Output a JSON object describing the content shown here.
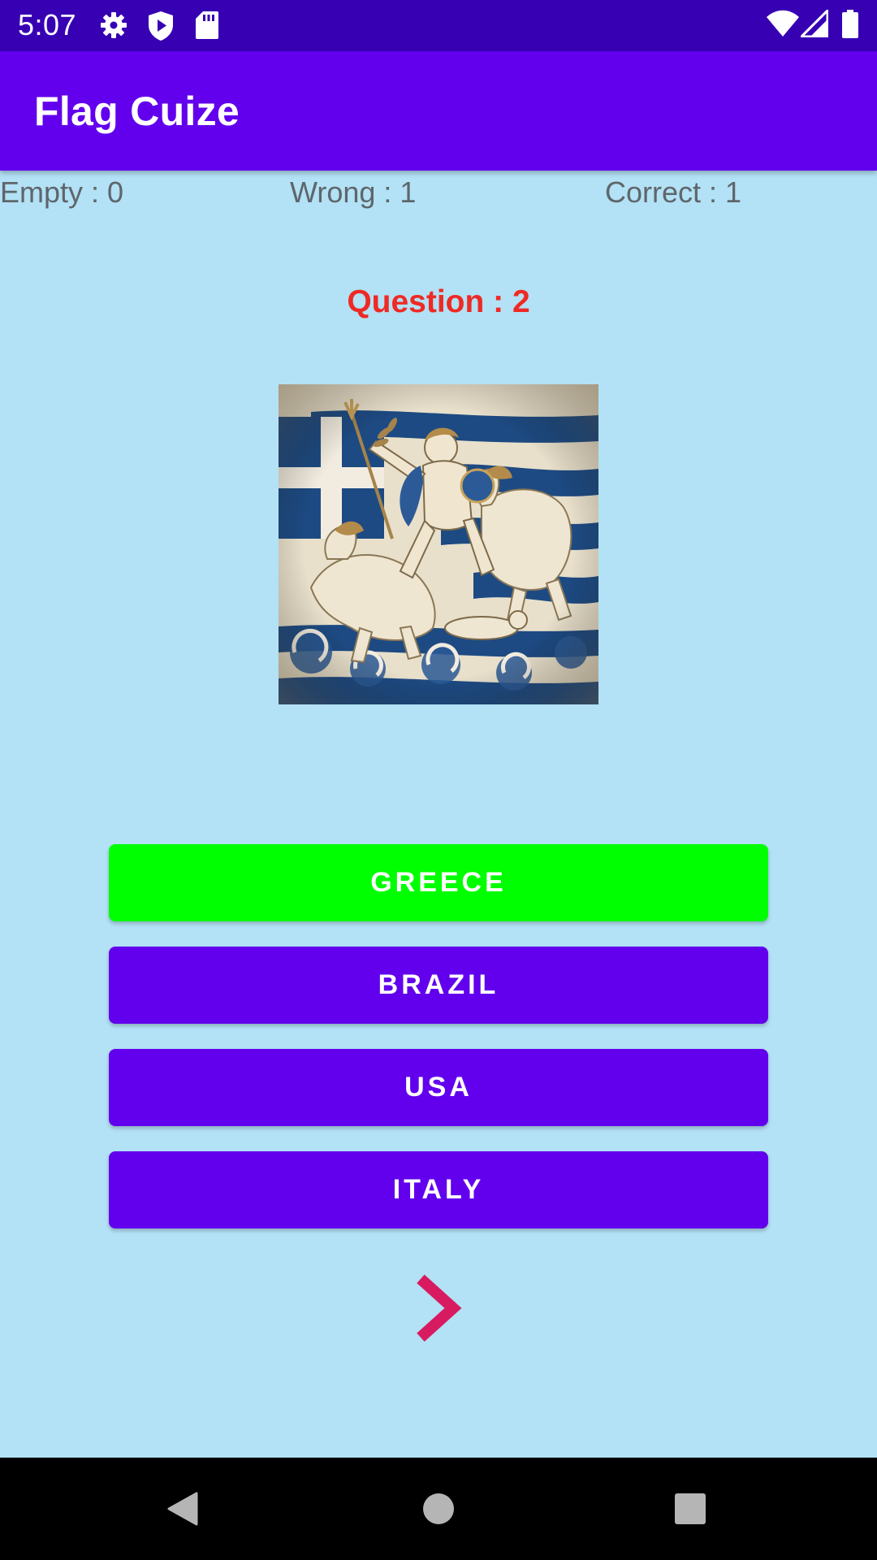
{
  "status_bar": {
    "time": "5:07",
    "icons": [
      "gear-icon",
      "shield-play-icon",
      "sd-card-icon",
      "wifi-icon",
      "cell-signal-icon",
      "battery-icon"
    ]
  },
  "app_bar": {
    "title": "Flag Cuize",
    "color": "#6200ee"
  },
  "score": {
    "empty": "Empty : 0",
    "wrong": "Wrong : 1",
    "correct": "Correct : 1"
  },
  "question": {
    "label": "Question : 2",
    "color": "#ee2a24"
  },
  "flag_image": {
    "subject": "greek-flag-mythological-artwork"
  },
  "answers": [
    {
      "label": "GREECE",
      "state": "correct",
      "color": "#00ff00"
    },
    {
      "label": "BRAZIL",
      "state": "default",
      "color": "#6200ee"
    },
    {
      "label": "USA",
      "state": "default",
      "color": "#6200ee"
    },
    {
      "label": "ITALY",
      "state": "default",
      "color": "#6200ee"
    }
  ],
  "next_button": {
    "icon": "chevron-right-icon",
    "color": "#d81b60"
  },
  "nav_bar": {
    "icons": [
      "back-icon",
      "home-icon",
      "recents-icon"
    ]
  },
  "colors": {
    "background": "#b3e1f5",
    "status_bar": "#3700b3"
  }
}
